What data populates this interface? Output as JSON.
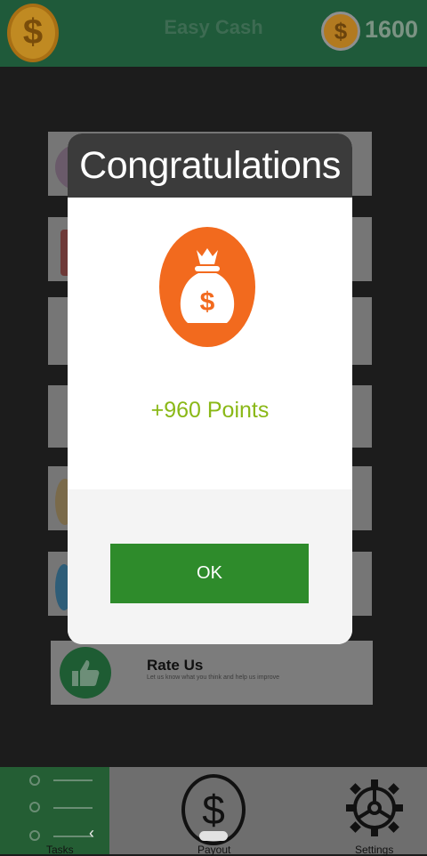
{
  "header": {
    "title": "Easy Cash",
    "coin_symbol": "$",
    "points_coin_symbol": "$",
    "points": "1600"
  },
  "rate_card": {
    "title": "Rate Us",
    "subtitle": "Let us know what you think and help us improve"
  },
  "dialog": {
    "title": "Congratulations",
    "reward_text": "+960 Points",
    "ok_label": "OK"
  },
  "bottom_nav": {
    "tasks_label": "Tasks",
    "payout_label": "Payout",
    "settings_label": "Settings",
    "payout_symbol": "$"
  },
  "colors": {
    "top_bar": "#1f5a3a",
    "dialog_header": "#3b3b3b",
    "bag_icon": "#f26a1e",
    "reward_text": "#8ab817",
    "ok_button": "#2e8b2b",
    "nav_tasks": "#245e34"
  }
}
